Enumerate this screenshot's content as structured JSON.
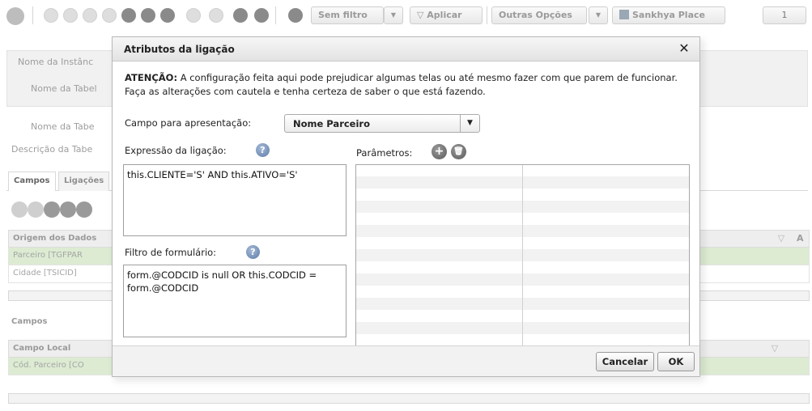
{
  "toolbar": {
    "filter_label": "Sem filtro",
    "apply_label": "Aplicar",
    "more_options_label": "Outras Opções",
    "sankhya_place_label": "Sankhya Place",
    "page_number": "1"
  },
  "background": {
    "label_instance_name": "Nome da Instânc",
    "label_table_name_1": "Nome da Tabel",
    "label_table_name_2": "Nome da Tabe",
    "label_table_description": "Descrição da Tabe",
    "tab_fields": "Campos",
    "tab_links": "Ligações",
    "grid1_header": "Origem dos Dados",
    "grid1_rows": [
      "Parceiro [TGFPAR",
      "Cidade [TSICID]"
    ],
    "section_fields": "Campos",
    "grid2_header": "Campo Local",
    "grid2_rows": [
      "Cód. Parceiro [CO"
    ],
    "right_col_header": "A"
  },
  "dialog": {
    "title": "Atributos da ligação",
    "warning_bold": "ATENÇÃO:",
    "warning_text": " A configuração feita aqui pode prejudicar algumas telas ou até mesmo fazer com que parem de funcionar. Faça as alterações com cautela e tenha certeza de saber o que está fazendo.",
    "presentation_field_label": "Campo para apresentação:",
    "presentation_field_value": "Nome Parceiro",
    "expression_label": "Expressão da ligação:",
    "expression_value": "this.CLIENTE='S' AND this.ATIVO='S'",
    "parameters_label": "Parâmetros:",
    "form_filter_label": "Filtro de formulário:",
    "form_filter_value": "form.@CODCID is null OR this.CODCID = form.@CODCID",
    "help_glyph": "?",
    "cancel_label": "Cancelar",
    "ok_label": "OK"
  },
  "icons": {
    "close": "✕",
    "dropdown": "▼",
    "add": "+",
    "delete": "🗑"
  }
}
